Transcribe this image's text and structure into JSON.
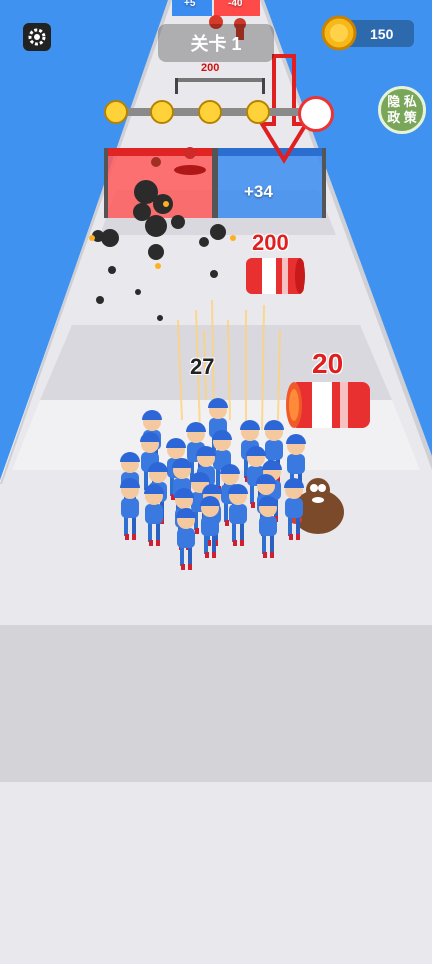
{
  "hud": {
    "level_label": "关卡 1",
    "coins": "150",
    "privacy_line1": "隐 私",
    "privacy_line2": "政 策",
    "settings_icon": "gear-icon",
    "coin_icon": "coin-icon",
    "boss_icon": "boss-icon"
  },
  "track": {
    "top_gate_left": "+5",
    "top_gate_right": "-40",
    "far_obstacle_value": "200",
    "gate_right_value": "+34"
  },
  "barrels": [
    {
      "value": "200"
    },
    {
      "value": "20"
    }
  ],
  "army": {
    "count": "27"
  },
  "colors": {
    "sky": "#3f92f0",
    "road": "#e6e6ea",
    "gate_red": "#ff4a4a",
    "gate_blue": "#3a8cf0",
    "soldier_blue": "#2f6fd0",
    "barrel_red": "#e02020"
  }
}
